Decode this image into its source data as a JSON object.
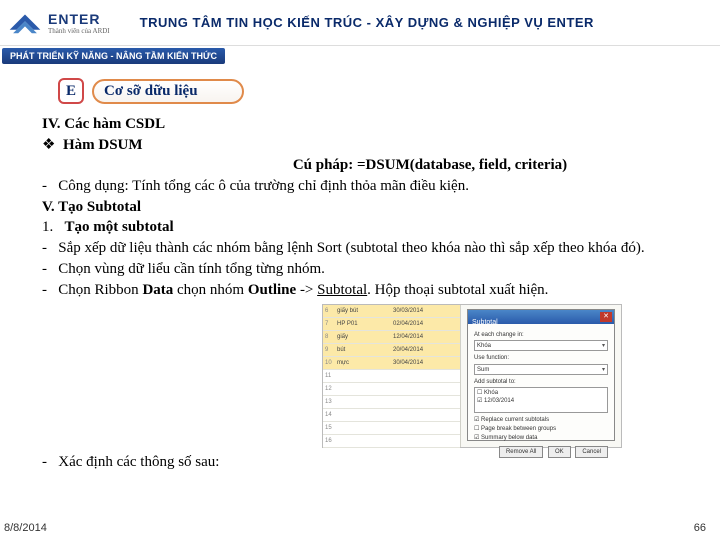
{
  "header": {
    "brand": "ENTER",
    "brand_sub": "Thành viên của ARDI",
    "title": "TRUNG TÂM TIN HỌC KIẾN TRÚC - XÂY DỰNG & NGHIỆP VỤ ENTER",
    "band": "PHÁT TRIỂN KỸ NĂNG - NÂNG TẦM KIẾN THỨC"
  },
  "section": {
    "letter": "E",
    "title": "Cơ sỡ dữu liệu"
  },
  "body": {
    "h4": "IV. Các hàm CSDL",
    "dsum_label": "Hàm DSUM",
    "syntax": "Cú pháp: =DSUM(database, field, criteria)",
    "usage": "Công dụng: Tính tổng các ô của trường chỉ định thỏa mãn điều kiện.",
    "h5": "V. Tạo Subtotal",
    "s1": "Tạo một subtotal",
    "b1": "Sắp xếp dữ liệu thành các nhóm bằng lệnh Sort (subtotal theo khóa nào thì sắp xếp theo khóa đó).",
    "b2": "Chọn vùng dữ liểu cần tính tổng từng nhóm.",
    "b3a": "Chọn Ribbon ",
    "b3b": "Data",
    "b3c": " chọn nhóm ",
    "b3d": "Outline",
    "b3e": " -> ",
    "b3f": "Subtotal",
    "b3g": ". Hộp thoại subtotal xuất hiện.",
    "b4": "Xác định các thông số sau:"
  },
  "dialog": {
    "title": "Subtotal",
    "lbl_change": "At each change in:",
    "val_change": "Khóa",
    "lbl_func": "Use function:",
    "val_func": "Sum",
    "lbl_add": "Add subtotal to:",
    "items": [
      "☐ Khóa",
      "☑ 12/03/2014"
    ],
    "chk1": "☑ Replace current subtotals",
    "chk2": "☐ Page break between groups",
    "chk3": "☑ Summary below data",
    "btn_remove": "Remove All",
    "btn_ok": "OK",
    "btn_cancel": "Cancel"
  },
  "table_rows": [
    {
      "n": "6",
      "a": "giấy bút",
      "b": "30/03/2014"
    },
    {
      "n": "7",
      "a": "HP P01",
      "b": "02/04/2014"
    },
    {
      "n": "8",
      "a": "giấy",
      "b": "12/04/2014"
    },
    {
      "n": "9",
      "a": "bút",
      "b": "20/04/2014"
    },
    {
      "n": "10",
      "a": "mực",
      "b": "30/04/2014"
    },
    {
      "n": "11",
      "a": "",
      "b": ""
    },
    {
      "n": "12",
      "a": "",
      "b": ""
    },
    {
      "n": "13",
      "a": "",
      "b": ""
    },
    {
      "n": "14",
      "a": "",
      "b": ""
    },
    {
      "n": "15",
      "a": "",
      "b": ""
    },
    {
      "n": "16",
      "a": "",
      "b": ""
    }
  ],
  "footer": {
    "date": "8/8/2014",
    "page": "66"
  }
}
